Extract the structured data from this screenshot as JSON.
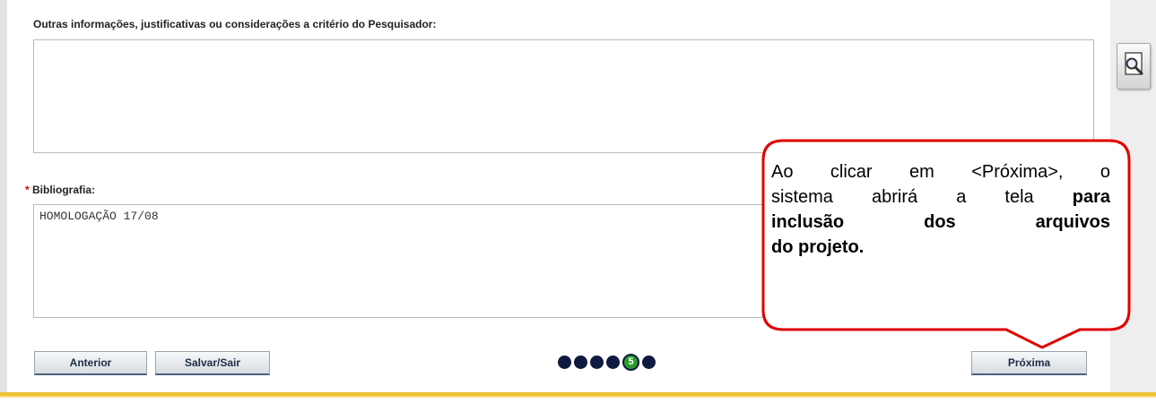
{
  "form": {
    "outras_label": "Outras informações, justificativas ou considerações a critério do Pesquisador:",
    "outras_value": "",
    "bibliografia_required_mark": "*",
    "bibliografia_label": "Bibliografia:",
    "bibliografia_value": "HOMOLOGAÇÃO 17/08"
  },
  "buttons": {
    "anterior": "Anterior",
    "salvar_sair": "Salvar/Sair",
    "proxima": "Próxima"
  },
  "steps": {
    "total": 6,
    "current": 5,
    "current_label": "5"
  },
  "callout": {
    "line1": "Ao clicar em <Próxima>, o",
    "line2_part1": "sistema abrirá a tela ",
    "line2_bold": "para",
    "line3_bold": "inclusão dos arquivos",
    "line4_bold": "do projeto.",
    "border_color": "#e00000"
  },
  "side": {
    "zoom_icon": "magnifier-page-icon"
  }
}
